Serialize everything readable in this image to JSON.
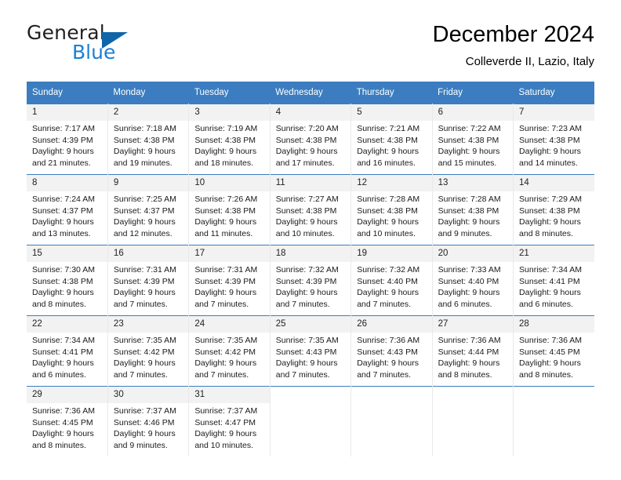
{
  "brand": {
    "word_one": "General",
    "word_two": "Blue",
    "triangle_icon": "triangle-icon",
    "accent_dark": "#1065a8",
    "accent_light": "#1b7fd4"
  },
  "header": {
    "title": "December 2024",
    "subtitle": "Colleverde II, Lazio, Italy"
  },
  "calendar": {
    "header_bg": "#3b7dc0",
    "daynum_bg": "#f2f2f2",
    "weekdays": [
      "Sunday",
      "Monday",
      "Tuesday",
      "Wednesday",
      "Thursday",
      "Friday",
      "Saturday"
    ],
    "weeks": [
      [
        {
          "day": "1",
          "sunrise": "Sunrise: 7:17 AM",
          "sunset": "Sunset: 4:39 PM",
          "daylight_1": "Daylight: 9 hours",
          "daylight_2": "and 21 minutes."
        },
        {
          "day": "2",
          "sunrise": "Sunrise: 7:18 AM",
          "sunset": "Sunset: 4:38 PM",
          "daylight_1": "Daylight: 9 hours",
          "daylight_2": "and 19 minutes."
        },
        {
          "day": "3",
          "sunrise": "Sunrise: 7:19 AM",
          "sunset": "Sunset: 4:38 PM",
          "daylight_1": "Daylight: 9 hours",
          "daylight_2": "and 18 minutes."
        },
        {
          "day": "4",
          "sunrise": "Sunrise: 7:20 AM",
          "sunset": "Sunset: 4:38 PM",
          "daylight_1": "Daylight: 9 hours",
          "daylight_2": "and 17 minutes."
        },
        {
          "day": "5",
          "sunrise": "Sunrise: 7:21 AM",
          "sunset": "Sunset: 4:38 PM",
          "daylight_1": "Daylight: 9 hours",
          "daylight_2": "and 16 minutes."
        },
        {
          "day": "6",
          "sunrise": "Sunrise: 7:22 AM",
          "sunset": "Sunset: 4:38 PM",
          "daylight_1": "Daylight: 9 hours",
          "daylight_2": "and 15 minutes."
        },
        {
          "day": "7",
          "sunrise": "Sunrise: 7:23 AM",
          "sunset": "Sunset: 4:38 PM",
          "daylight_1": "Daylight: 9 hours",
          "daylight_2": "and 14 minutes."
        }
      ],
      [
        {
          "day": "8",
          "sunrise": "Sunrise: 7:24 AM",
          "sunset": "Sunset: 4:37 PM",
          "daylight_1": "Daylight: 9 hours",
          "daylight_2": "and 13 minutes."
        },
        {
          "day": "9",
          "sunrise": "Sunrise: 7:25 AM",
          "sunset": "Sunset: 4:37 PM",
          "daylight_1": "Daylight: 9 hours",
          "daylight_2": "and 12 minutes."
        },
        {
          "day": "10",
          "sunrise": "Sunrise: 7:26 AM",
          "sunset": "Sunset: 4:38 PM",
          "daylight_1": "Daylight: 9 hours",
          "daylight_2": "and 11 minutes."
        },
        {
          "day": "11",
          "sunrise": "Sunrise: 7:27 AM",
          "sunset": "Sunset: 4:38 PM",
          "daylight_1": "Daylight: 9 hours",
          "daylight_2": "and 10 minutes."
        },
        {
          "day": "12",
          "sunrise": "Sunrise: 7:28 AM",
          "sunset": "Sunset: 4:38 PM",
          "daylight_1": "Daylight: 9 hours",
          "daylight_2": "and 10 minutes."
        },
        {
          "day": "13",
          "sunrise": "Sunrise: 7:28 AM",
          "sunset": "Sunset: 4:38 PM",
          "daylight_1": "Daylight: 9 hours",
          "daylight_2": "and 9 minutes."
        },
        {
          "day": "14",
          "sunrise": "Sunrise: 7:29 AM",
          "sunset": "Sunset: 4:38 PM",
          "daylight_1": "Daylight: 9 hours",
          "daylight_2": "and 8 minutes."
        }
      ],
      [
        {
          "day": "15",
          "sunrise": "Sunrise: 7:30 AM",
          "sunset": "Sunset: 4:38 PM",
          "daylight_1": "Daylight: 9 hours",
          "daylight_2": "and 8 minutes."
        },
        {
          "day": "16",
          "sunrise": "Sunrise: 7:31 AM",
          "sunset": "Sunset: 4:39 PM",
          "daylight_1": "Daylight: 9 hours",
          "daylight_2": "and 7 minutes."
        },
        {
          "day": "17",
          "sunrise": "Sunrise: 7:31 AM",
          "sunset": "Sunset: 4:39 PM",
          "daylight_1": "Daylight: 9 hours",
          "daylight_2": "and 7 minutes."
        },
        {
          "day": "18",
          "sunrise": "Sunrise: 7:32 AM",
          "sunset": "Sunset: 4:39 PM",
          "daylight_1": "Daylight: 9 hours",
          "daylight_2": "and 7 minutes."
        },
        {
          "day": "19",
          "sunrise": "Sunrise: 7:32 AM",
          "sunset": "Sunset: 4:40 PM",
          "daylight_1": "Daylight: 9 hours",
          "daylight_2": "and 7 minutes."
        },
        {
          "day": "20",
          "sunrise": "Sunrise: 7:33 AM",
          "sunset": "Sunset: 4:40 PM",
          "daylight_1": "Daylight: 9 hours",
          "daylight_2": "and 6 minutes."
        },
        {
          "day": "21",
          "sunrise": "Sunrise: 7:34 AM",
          "sunset": "Sunset: 4:41 PM",
          "daylight_1": "Daylight: 9 hours",
          "daylight_2": "and 6 minutes."
        }
      ],
      [
        {
          "day": "22",
          "sunrise": "Sunrise: 7:34 AM",
          "sunset": "Sunset: 4:41 PM",
          "daylight_1": "Daylight: 9 hours",
          "daylight_2": "and 6 minutes."
        },
        {
          "day": "23",
          "sunrise": "Sunrise: 7:35 AM",
          "sunset": "Sunset: 4:42 PM",
          "daylight_1": "Daylight: 9 hours",
          "daylight_2": "and 7 minutes."
        },
        {
          "day": "24",
          "sunrise": "Sunrise: 7:35 AM",
          "sunset": "Sunset: 4:42 PM",
          "daylight_1": "Daylight: 9 hours",
          "daylight_2": "and 7 minutes."
        },
        {
          "day": "25",
          "sunrise": "Sunrise: 7:35 AM",
          "sunset": "Sunset: 4:43 PM",
          "daylight_1": "Daylight: 9 hours",
          "daylight_2": "and 7 minutes."
        },
        {
          "day": "26",
          "sunrise": "Sunrise: 7:36 AM",
          "sunset": "Sunset: 4:43 PM",
          "daylight_1": "Daylight: 9 hours",
          "daylight_2": "and 7 minutes."
        },
        {
          "day": "27",
          "sunrise": "Sunrise: 7:36 AM",
          "sunset": "Sunset: 4:44 PM",
          "daylight_1": "Daylight: 9 hours",
          "daylight_2": "and 8 minutes."
        },
        {
          "day": "28",
          "sunrise": "Sunrise: 7:36 AM",
          "sunset": "Sunset: 4:45 PM",
          "daylight_1": "Daylight: 9 hours",
          "daylight_2": "and 8 minutes."
        }
      ],
      [
        {
          "day": "29",
          "sunrise": "Sunrise: 7:36 AM",
          "sunset": "Sunset: 4:45 PM",
          "daylight_1": "Daylight: 9 hours",
          "daylight_2": "and 8 minutes."
        },
        {
          "day": "30",
          "sunrise": "Sunrise: 7:37 AM",
          "sunset": "Sunset: 4:46 PM",
          "daylight_1": "Daylight: 9 hours",
          "daylight_2": "and 9 minutes."
        },
        {
          "day": "31",
          "sunrise": "Sunrise: 7:37 AM",
          "sunset": "Sunset: 4:47 PM",
          "daylight_1": "Daylight: 9 hours",
          "daylight_2": "and 10 minutes."
        },
        {
          "day": "",
          "sunrise": "",
          "sunset": "",
          "daylight_1": "",
          "daylight_2": ""
        },
        {
          "day": "",
          "sunrise": "",
          "sunset": "",
          "daylight_1": "",
          "daylight_2": ""
        },
        {
          "day": "",
          "sunrise": "",
          "sunset": "",
          "daylight_1": "",
          "daylight_2": ""
        },
        {
          "day": "",
          "sunrise": "",
          "sunset": "",
          "daylight_1": "",
          "daylight_2": ""
        }
      ]
    ]
  }
}
